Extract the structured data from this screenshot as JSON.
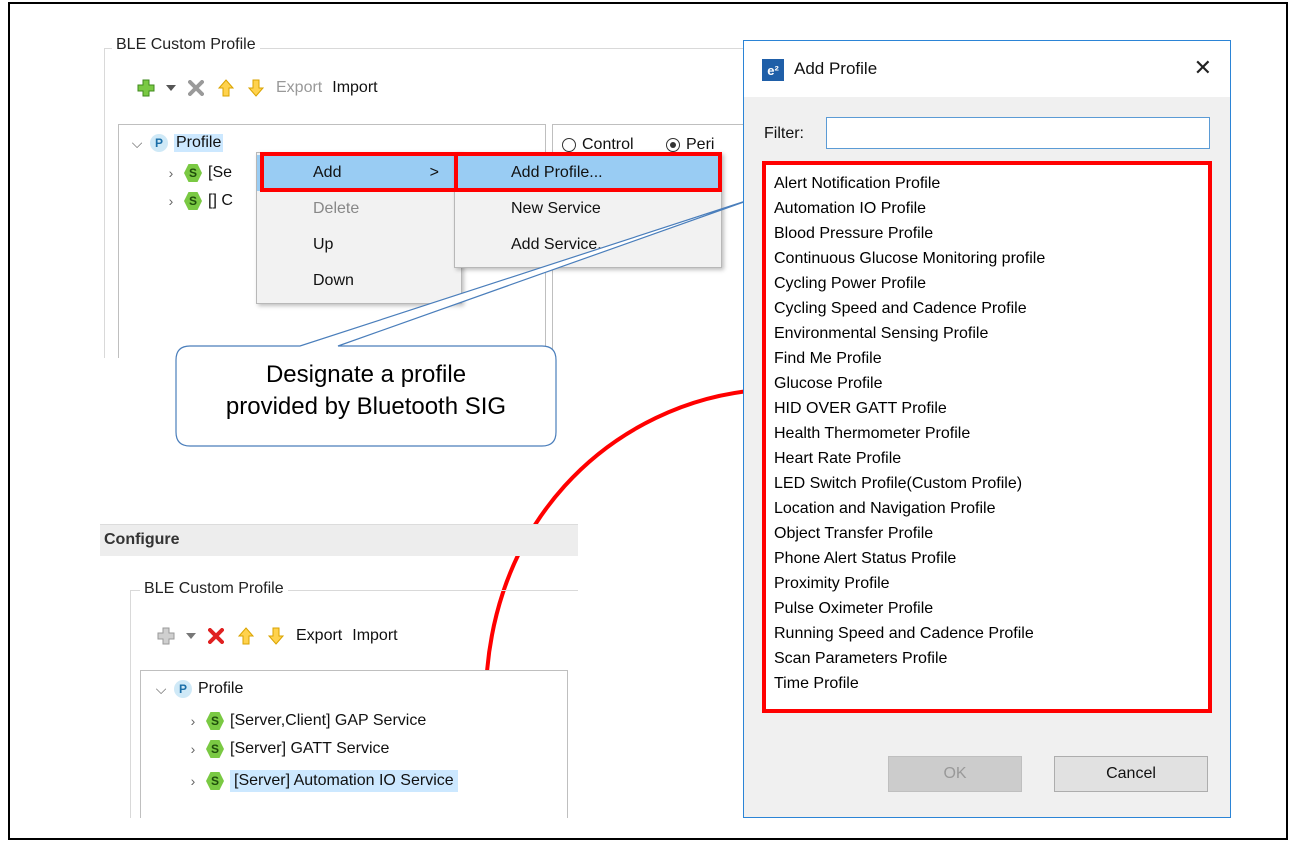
{
  "top_panel": {
    "group_title": "BLE Custom Profile",
    "toolbar": {
      "export": "Export",
      "import": "Import"
    },
    "tree": {
      "root": "Profile",
      "item1": "[Se",
      "item2": "[] C"
    },
    "radio": {
      "control": "Control",
      "peri": "Peri"
    }
  },
  "context_menu": {
    "items": [
      "Add",
      "Delete",
      "Up",
      "Down"
    ],
    "submenu_arrow": ">",
    "submenu": [
      "Add Profile...",
      "New Service",
      "Add Service..."
    ]
  },
  "callout": {
    "line1": "Designate a profile",
    "line2": "provided by Bluetooth SIG"
  },
  "configure_panel": {
    "header": "Configure",
    "group_title": "BLE Custom Profile",
    "toolbar": {
      "export": "Export",
      "import": "Import"
    },
    "tree": {
      "root": "Profile",
      "items": [
        "[Server,Client] GAP Service",
        "[Server] GATT Service",
        "[Server] Automation IO Service"
      ]
    }
  },
  "dialog": {
    "logo": "e²",
    "title": "Add Profile",
    "close": "✕",
    "filter_label": "Filter:",
    "filter_value": "",
    "profiles": [
      "Alert Notification Profile",
      "Automation IO Profile",
      "Blood Pressure Profile",
      "Continuous Glucose Monitoring profile",
      "Cycling Power Profile",
      "Cycling Speed and Cadence Profile",
      "Environmental Sensing Profile",
      "Find Me Profile",
      "Glucose Profile",
      "HID OVER GATT Profile",
      "Health Thermometer Profile",
      "Heart Rate Profile",
      "LED Switch Profile(Custom Profile)",
      "Location and Navigation Profile",
      "Object Transfer Profile",
      "Phone Alert Status Profile",
      "Proximity Profile",
      "Pulse Oximeter Profile",
      "Running Speed and Cadence Profile",
      "Scan Parameters Profile",
      "Time Profile"
    ],
    "ok": "OK",
    "cancel": "Cancel"
  },
  "colors": {
    "highlight": "#ff0000",
    "menu_selection": "#99ccf3",
    "dialog_border": "#2b84d6",
    "tree_selection": "#cce8ff"
  }
}
